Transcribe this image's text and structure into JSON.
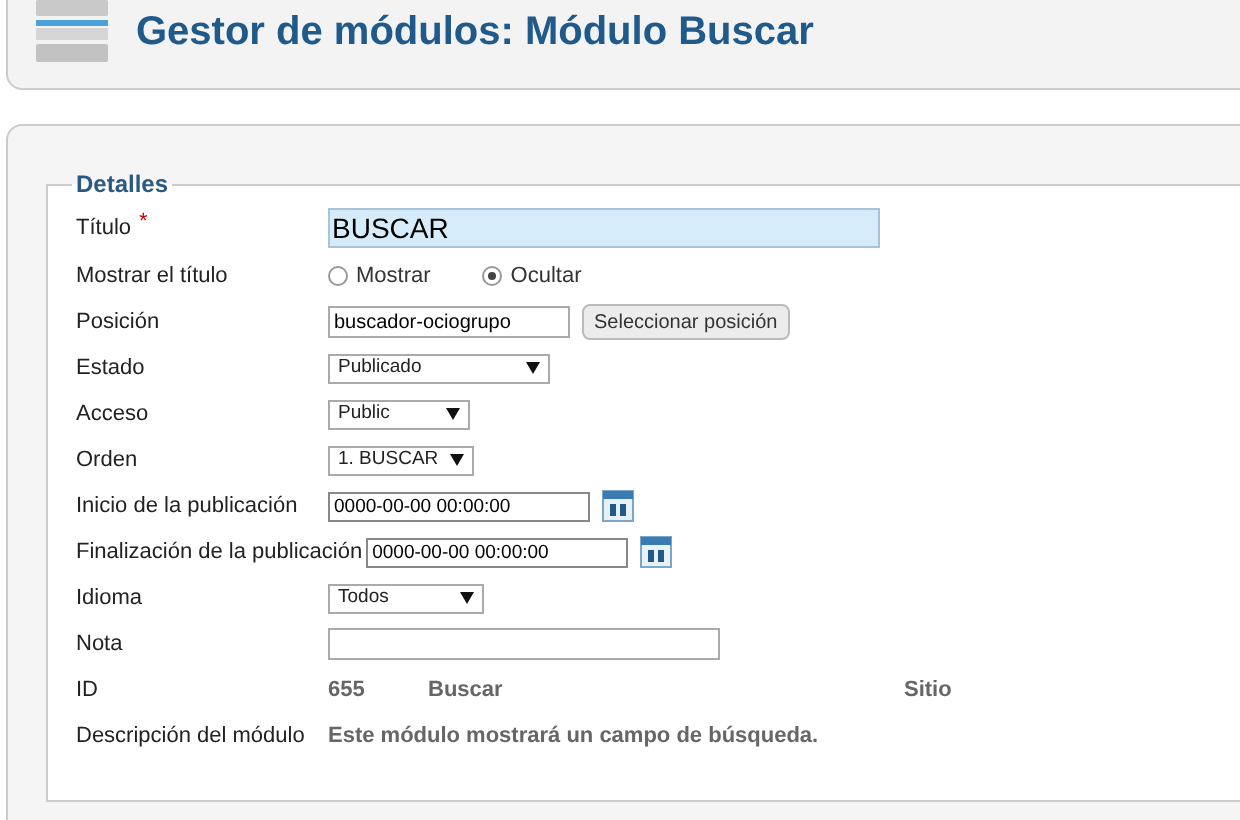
{
  "header": {
    "title": "Gestor de módulos: Módulo Buscar"
  },
  "fieldset": {
    "legend": "Detalles"
  },
  "fields": [
    {
      "kind": "text",
      "label": "Título",
      "required_mark": "*",
      "value": "BUSCAR",
      "highlighted": true
    },
    {
      "kind": "radio",
      "label": "Mostrar el título",
      "options": [
        {
          "label": "Mostrar",
          "selected": false
        },
        {
          "label": "Ocultar",
          "selected": true
        }
      ]
    },
    {
      "kind": "text",
      "label": "Posición",
      "value": "buscador-ociogrupo",
      "button": "Seleccionar posición",
      "highlighted": false
    },
    {
      "kind": "select",
      "label": "Estado",
      "value": "Publicado"
    },
    {
      "kind": "select",
      "label": "Acceso",
      "value": "Public"
    },
    {
      "kind": "select",
      "label": "Orden",
      "value": "1. BUSCAR"
    },
    {
      "kind": "date",
      "label": "Inicio de la publicación",
      "value": "0000-00-00 00:00:00"
    },
    {
      "kind": "date",
      "label": "Finalización de la publicación",
      "value": "0000-00-00 00:00:00"
    },
    {
      "kind": "select",
      "label": "Idioma",
      "value": "Todos"
    },
    {
      "kind": "text",
      "label": "Nota",
      "highlighted": false
    },
    {
      "kind": "info",
      "label": "ID",
      "values": [
        "655",
        "Buscar",
        "Sitio"
      ]
    },
    {
      "kind": "info",
      "label": "Descripción del módulo",
      "values": [
        "Este módulo mostrará un campo de búsqueda."
      ]
    }
  ]
}
